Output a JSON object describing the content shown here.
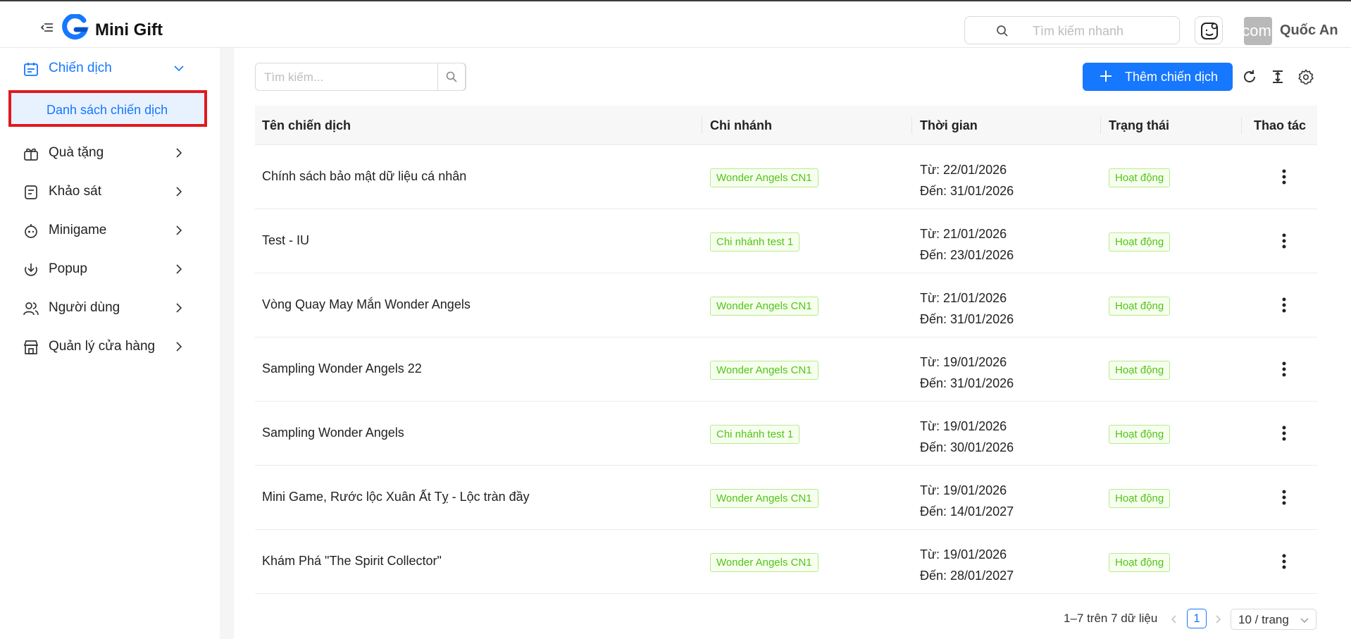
{
  "header": {
    "app_name": "Mini Gift",
    "quick_search_placeholder": "Tìm kiếm nhanh",
    "user_name": "Quốc An",
    "avatar_text": "com"
  },
  "sidebar": {
    "items": [
      {
        "label": "Chiến dịch",
        "icon": "calendar-icon",
        "expanded": true
      },
      {
        "label": "Quà tặng",
        "icon": "gift-icon"
      },
      {
        "label": "Khảo sát",
        "icon": "survey-icon"
      },
      {
        "label": "Minigame",
        "icon": "game-icon"
      },
      {
        "label": "Popup",
        "icon": "popup-icon"
      },
      {
        "label": "Người dùng",
        "icon": "users-icon"
      },
      {
        "label": "Quản lý cửa hàng",
        "icon": "store-icon"
      }
    ],
    "sub_item_active": "Danh sách chiến dịch"
  },
  "toolbar": {
    "search_placeholder": "Tìm kiếm...",
    "add_button_label": "Thêm chiến dịch"
  },
  "table": {
    "columns": [
      "Tên chiến dịch",
      "Chi nhánh",
      "Thời gian",
      "Trạng thái",
      "Thao tác"
    ],
    "rows": [
      {
        "name": "Chính sách bảo mật dữ liệu cá nhân",
        "branch": "Wonder Angels CN1",
        "from": "Từ: 22/01/2026",
        "to": "Đến: 31/01/2026",
        "status": "Hoạt động"
      },
      {
        "name": "Test - IU",
        "branch": "Chi nhánh test 1",
        "from": "Từ: 21/01/2026",
        "to": "Đến: 23/01/2026",
        "status": "Hoạt động"
      },
      {
        "name": "Vòng Quay May Mắn Wonder Angels",
        "branch": "Wonder Angels CN1",
        "from": "Từ: 21/01/2026",
        "to": "Đến: 31/01/2026",
        "status": "Hoạt động"
      },
      {
        "name": "Sampling Wonder Angels 22",
        "branch": "Wonder Angels CN1",
        "from": "Từ: 19/01/2026",
        "to": "Đến: 31/01/2026",
        "status": "Hoạt động"
      },
      {
        "name": "Sampling Wonder Angels",
        "branch": "Chi nhánh test 1",
        "from": "Từ: 19/01/2026",
        "to": "Đến: 30/01/2026",
        "status": "Hoạt động"
      },
      {
        "name": "Mini Game, Rước lộc Xuân Ất Tỵ - Lộc tràn đầy",
        "branch": "Wonder Angels CN1",
        "from": "Từ: 19/01/2026",
        "to": "Đến: 14/01/2027",
        "status": "Hoạt động"
      },
      {
        "name": "Khám Phá \"The Spirit Collector\"",
        "branch": "Wonder Angels CN1",
        "from": "Từ: 19/01/2026",
        "to": "Đến: 28/01/2027",
        "status": "Hoạt động"
      }
    ]
  },
  "pagination": {
    "info": "1–7 trên 7 dữ liệu",
    "current_page": "1",
    "page_size": "10 / trang"
  },
  "colors": {
    "primary": "#1677ff",
    "success": "#52c41a",
    "annotation": "#e0191f"
  }
}
